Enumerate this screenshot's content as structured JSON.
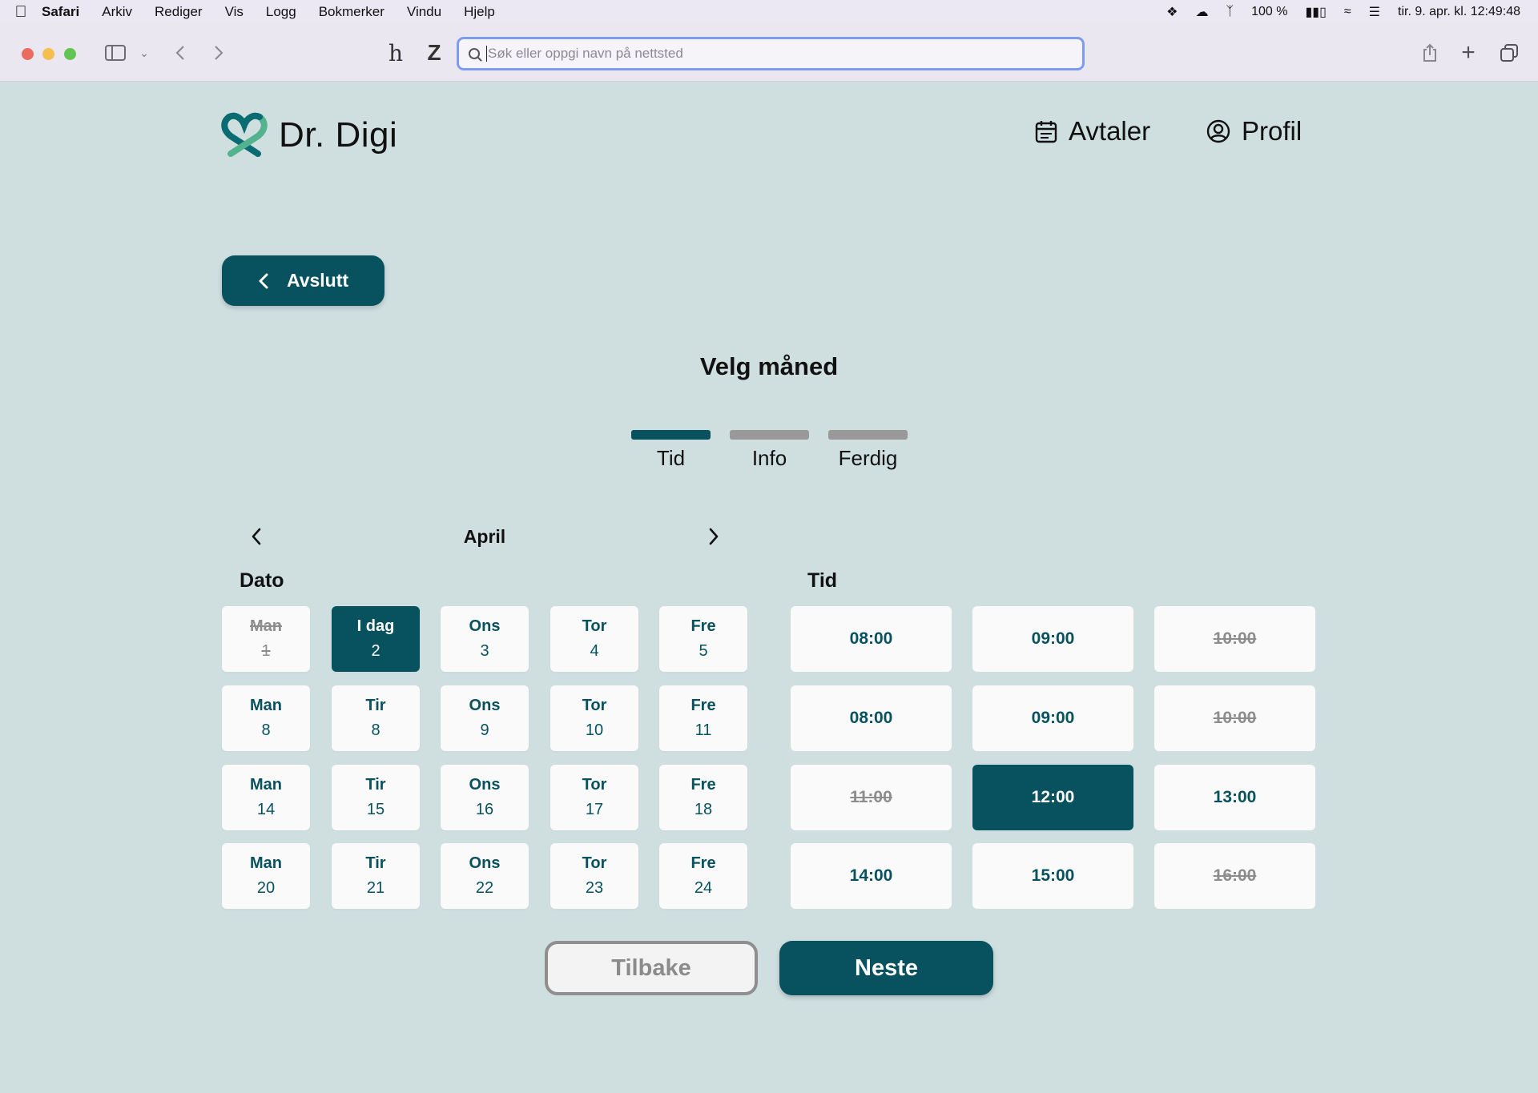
{
  "menubar": {
    "app": "Safari",
    "items": [
      "Arkiv",
      "Rediger",
      "Vis",
      "Logg",
      "Bokmerker",
      "Vindu",
      "Hjelp"
    ],
    "battery": "100 %",
    "clock": "tir. 9. apr. kl. 12:49:48"
  },
  "browser": {
    "address_placeholder": "Søk eller oppgi navn på nettsted"
  },
  "app": {
    "logo_text": "Dr. Digi",
    "nav": {
      "appointments": "Avtaler",
      "profile": "Profil"
    },
    "exit_label": "Avslutt",
    "page_title": "Velg måned",
    "steps": [
      {
        "label": "Tid",
        "active": true
      },
      {
        "label": "Info",
        "active": false
      },
      {
        "label": "Ferdig",
        "active": false
      }
    ],
    "month": "April",
    "date_section_label": "Dato",
    "time_section_label": "Tid",
    "dates": [
      {
        "day": "Man",
        "num": "1",
        "state": "disabled"
      },
      {
        "day": "I dag",
        "num": "2",
        "state": "selected"
      },
      {
        "day": "Ons",
        "num": "3",
        "state": "available"
      },
      {
        "day": "Tor",
        "num": "4",
        "state": "available"
      },
      {
        "day": "Fre",
        "num": "5",
        "state": "available"
      },
      {
        "day": "Man",
        "num": "8",
        "state": "available"
      },
      {
        "day": "Tir",
        "num": "8",
        "state": "available"
      },
      {
        "day": "Ons",
        "num": "9",
        "state": "available"
      },
      {
        "day": "Tor",
        "num": "10",
        "state": "available"
      },
      {
        "day": "Fre",
        "num": "11",
        "state": "available"
      },
      {
        "day": "Man",
        "num": "14",
        "state": "available"
      },
      {
        "day": "Tir",
        "num": "15",
        "state": "available"
      },
      {
        "day": "Ons",
        "num": "16",
        "state": "available"
      },
      {
        "day": "Tor",
        "num": "17",
        "state": "available"
      },
      {
        "day": "Fre",
        "num": "18",
        "state": "available"
      },
      {
        "day": "Man",
        "num": "20",
        "state": "available"
      },
      {
        "day": "Tir",
        "num": "21",
        "state": "available"
      },
      {
        "day": "Ons",
        "num": "22",
        "state": "available"
      },
      {
        "day": "Tor",
        "num": "23",
        "state": "available"
      },
      {
        "day": "Fre",
        "num": "24",
        "state": "available"
      }
    ],
    "times": [
      {
        "time": "08:00",
        "state": "available"
      },
      {
        "time": "09:00",
        "state": "available"
      },
      {
        "time": "10:00",
        "state": "disabled"
      },
      {
        "time": "08:00",
        "state": "available"
      },
      {
        "time": "09:00",
        "state": "available"
      },
      {
        "time": "10:00",
        "state": "disabled"
      },
      {
        "time": "11:00",
        "state": "disabled"
      },
      {
        "time": "12:00",
        "state": "selected"
      },
      {
        "time": "13:00",
        "state": "available"
      },
      {
        "time": "14:00",
        "state": "available"
      },
      {
        "time": "15:00",
        "state": "available"
      },
      {
        "time": "16:00",
        "state": "disabled"
      }
    ],
    "back_label": "Tilbake",
    "next_label": "Neste"
  },
  "colors": {
    "primary": "#08525f",
    "background": "#cfdfe0",
    "inactive_step": "#999999",
    "logo_teal": "#0b6b73",
    "logo_green": "#53b38f"
  },
  "icons": {
    "appointments": "calendar-icon",
    "profile": "user-circle-icon",
    "exit": "chevron-left-icon",
    "month_prev": "chevron-left-icon",
    "month_next": "chevron-right-icon"
  }
}
